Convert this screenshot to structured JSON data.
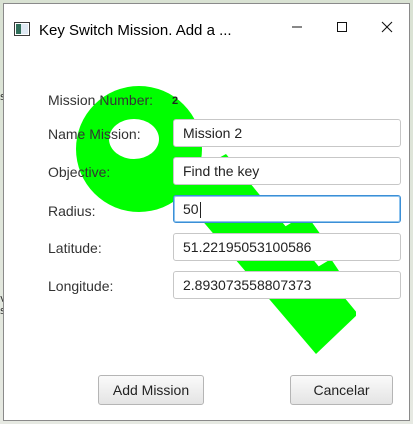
{
  "window": {
    "title": "Key Switch Mission. Add a ...",
    "minimize_glyph": "—",
    "maximize_glyph": "☐",
    "close_glyph": "✕"
  },
  "background": {
    "snippet_1": "s",
    "snippet_2": "v",
    "snippet_3": "s"
  },
  "form": {
    "mission_number_label": "Mission Number:",
    "mission_number_value": "2",
    "name_label": "Name Mission:",
    "name_value": "Mission 2",
    "objective_label": "Objective:",
    "objective_value": "Find the key",
    "radius_label": "Radius:",
    "radius_value": "50",
    "latitude_label": "Latitude:",
    "latitude_value": "51.22195053100586",
    "longitude_label": "Longitude:",
    "longitude_value": "2.893073558807373"
  },
  "buttons": {
    "add_label": "Add Mission",
    "cancel_label": "Cancelar"
  },
  "colors": {
    "key_art": "#00ff00",
    "focus_border": "#3c8fd6"
  },
  "icons": {
    "app": "app-window-icon",
    "key": "key-icon"
  }
}
